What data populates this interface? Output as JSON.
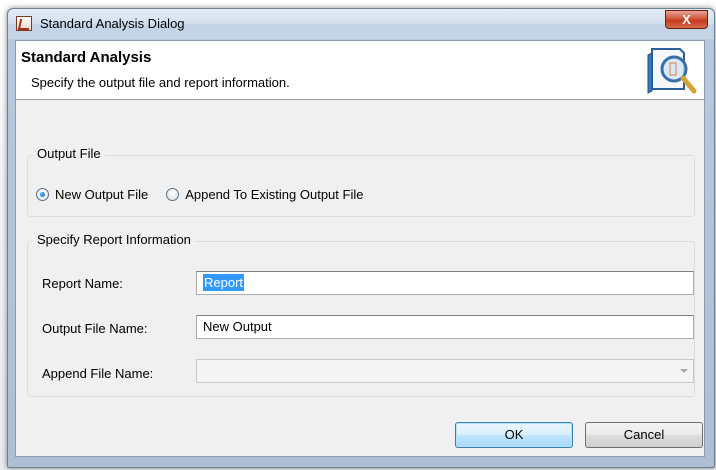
{
  "window": {
    "title": "Standard Analysis Dialog",
    "close_glyph": "X"
  },
  "header": {
    "title": "Standard Analysis",
    "description": "Specify the output file and report information.",
    "logo_icon": "magnifier-report-icon"
  },
  "output_file": {
    "group_label": "Output File",
    "options": [
      {
        "label": "New Output File",
        "checked": true
      },
      {
        "label": "Append To Existing Output File",
        "checked": false
      }
    ]
  },
  "report_info": {
    "group_label": "Specify Report Information",
    "report_name": {
      "label": "Report Name:",
      "value": "Report"
    },
    "output_file_name": {
      "label": "Output File Name:",
      "value": "New Output"
    },
    "append_file_name": {
      "label": "Append File Name:",
      "value": ""
    }
  },
  "buttons": {
    "ok": "OK",
    "cancel": "Cancel"
  },
  "colors": {
    "selection": "#3399ff",
    "close_button": "#c43a1f",
    "default_button_border": "#3c7fb1"
  }
}
